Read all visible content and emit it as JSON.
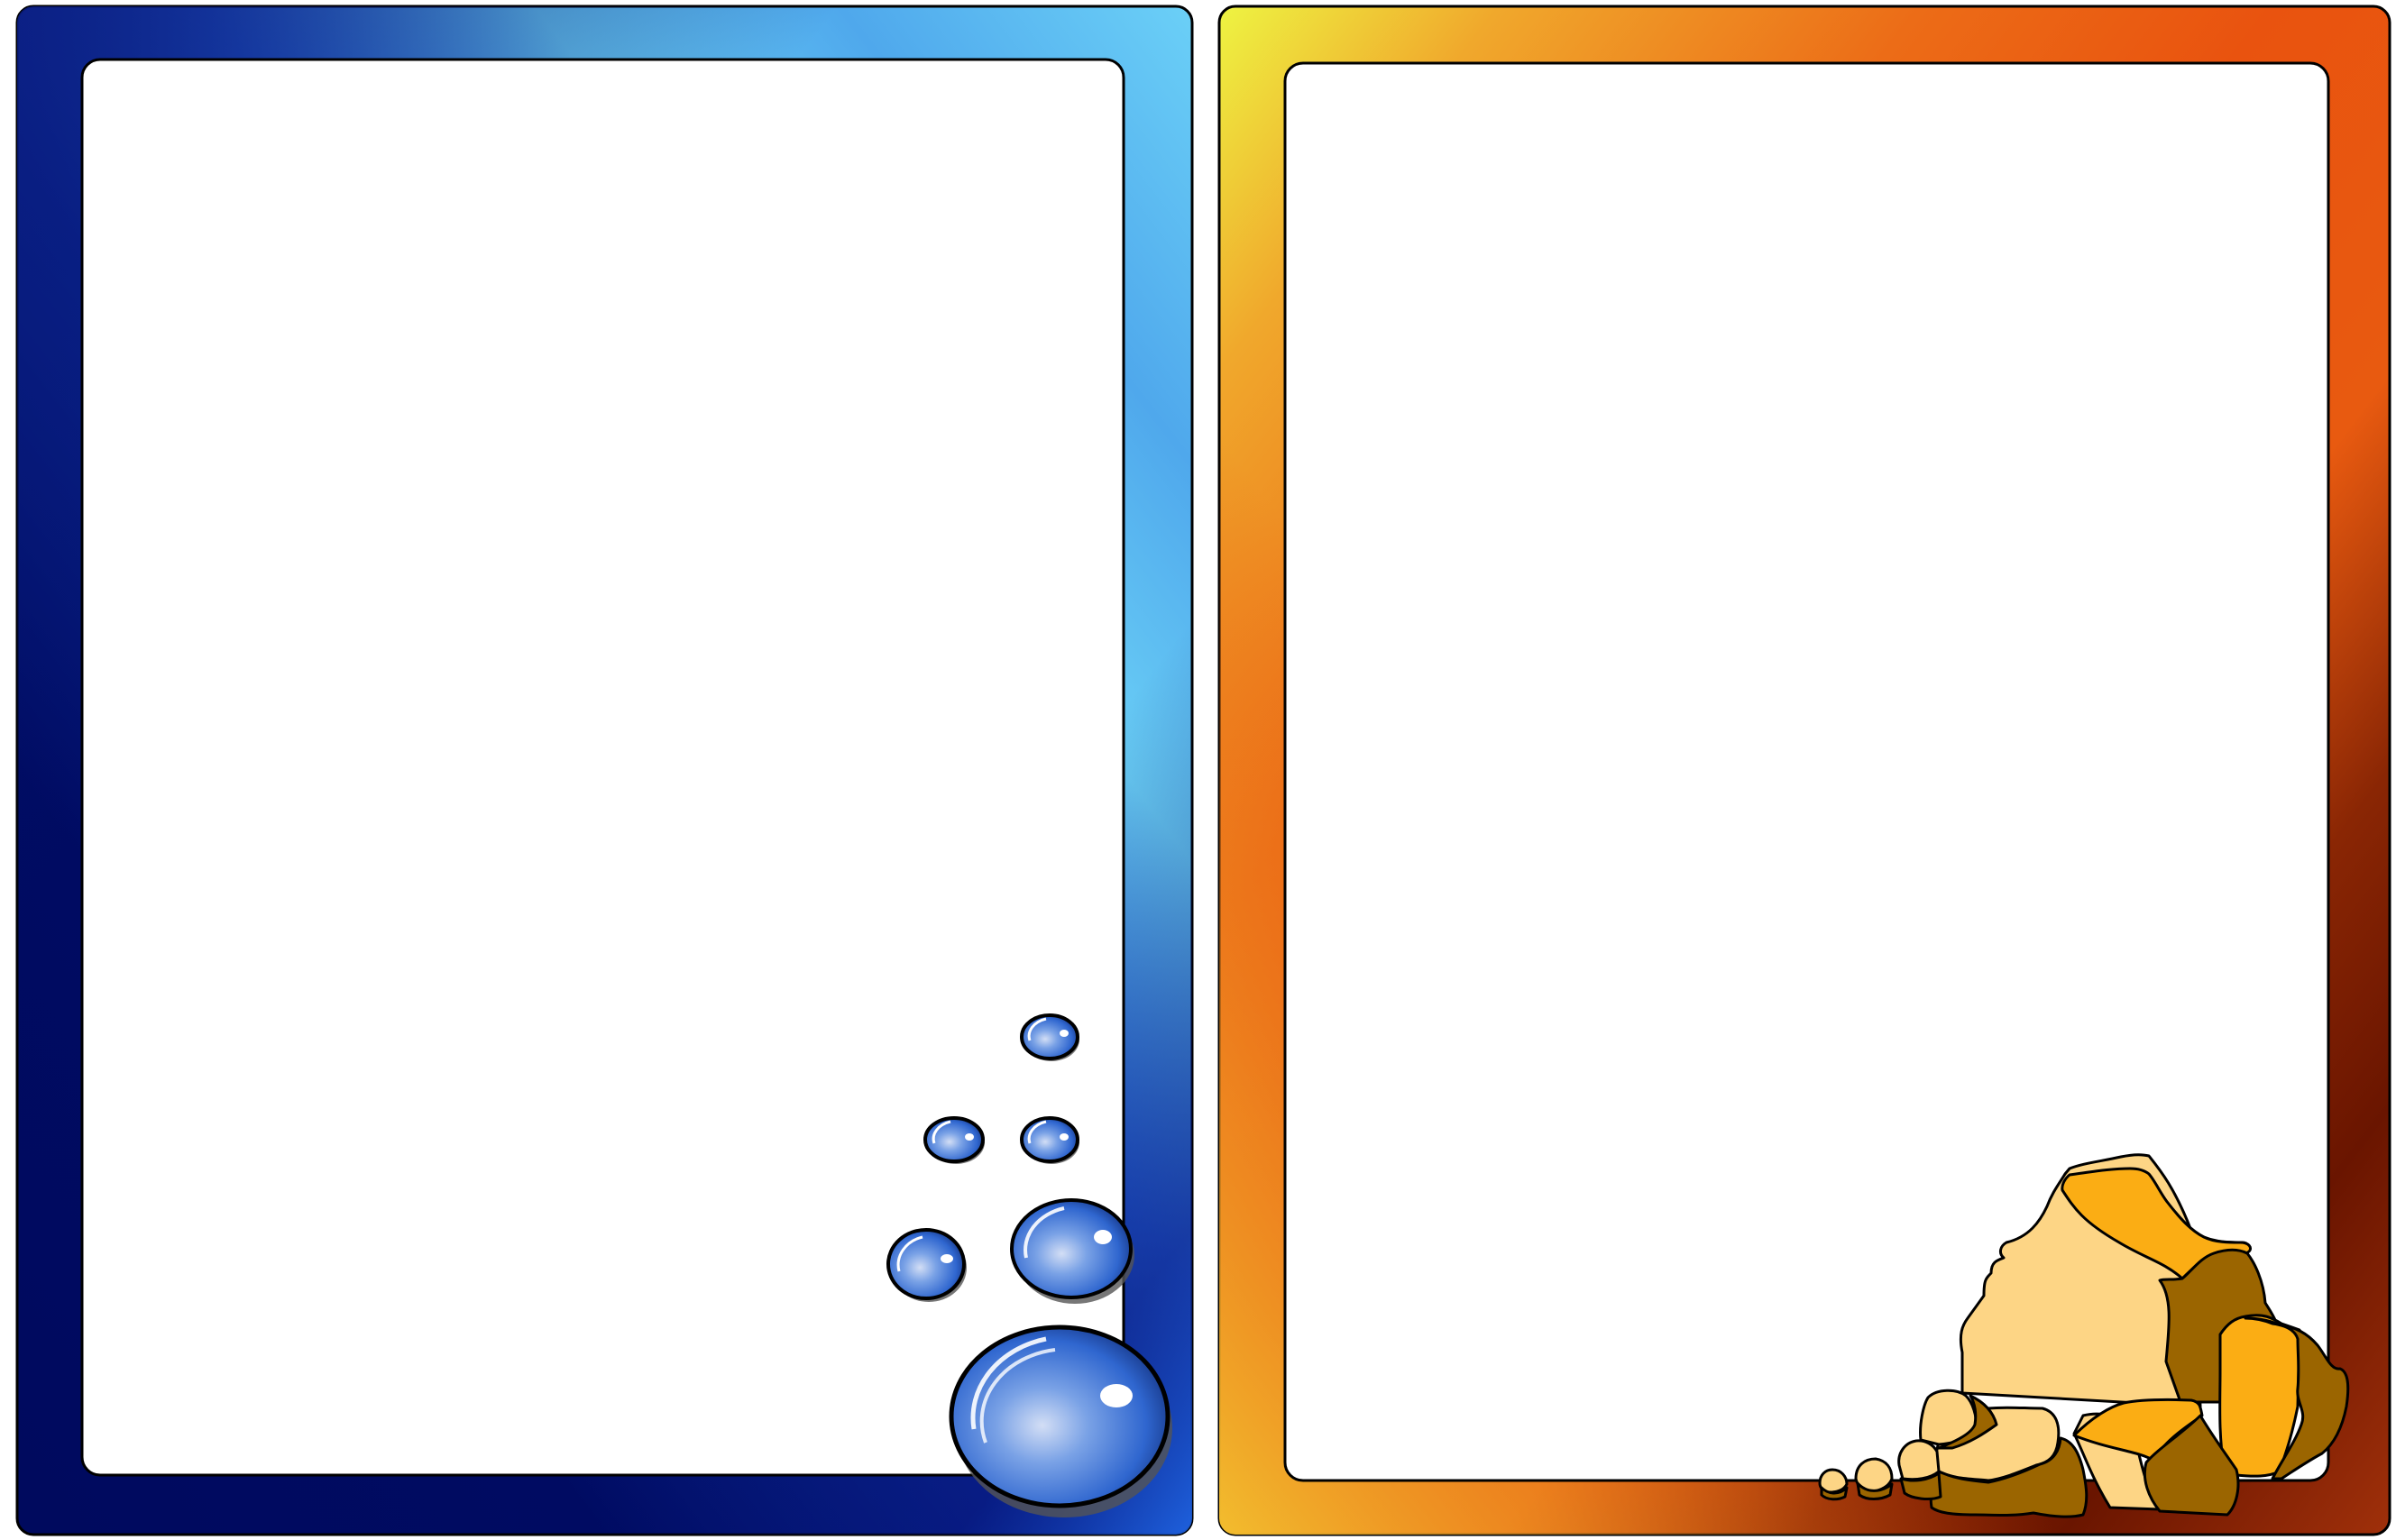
{
  "frames": [
    {
      "name": "water-frame",
      "theme": "water",
      "border_gradient": [
        "#000b5c",
        "#0a1e86",
        "#1e62e0",
        "#6bcff6",
        "#64c7f4",
        "#2a73e0",
        "#000a60",
        "#1e62e0"
      ],
      "inner_fill": "#ffffff",
      "decoration": "bubbles-icon",
      "bubble_count": 6,
      "bubble_colors": {
        "edge": "#1b3f93",
        "mid": "#4b7fdc",
        "highlight": "#c7d6f3"
      }
    },
    {
      "name": "earth-frame",
      "theme": "earth",
      "border_gradient": [
        "#eef442",
        "#f0a32a",
        "#ea5e12",
        "#e8530f",
        "#6a1500",
        "#7a1e00",
        "#b2350b"
      ],
      "inner_fill": "#ffffff",
      "decoration": "rocks-icon",
      "rock_colors": {
        "light": "#fdd585",
        "mid": "#fbad14",
        "dark": "#9b6500"
      }
    }
  ]
}
